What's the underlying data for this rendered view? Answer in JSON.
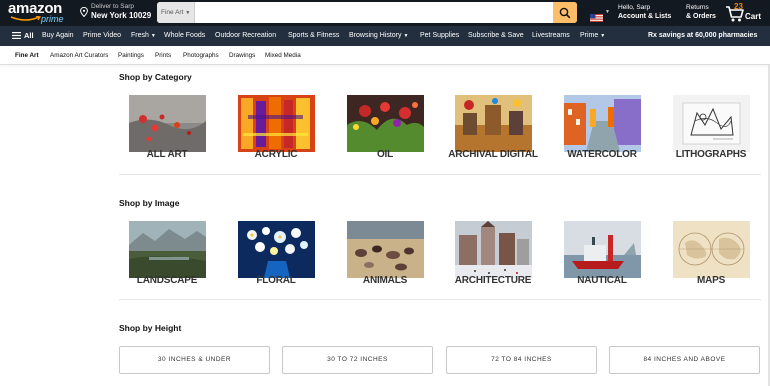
{
  "header": {
    "logo_text": "amazon",
    "logo_sub": "prime",
    "deliver_line1": "Deliver to Sarp",
    "deliver_line2": "New York 10029",
    "search_category": "Fine Art",
    "search_value": "",
    "search_placeholder": "",
    "account_line1": "Hello, Sarp",
    "account_line2": "Account & Lists",
    "orders_line1": "Returns",
    "orders_line2": "& Orders",
    "cart_count": "23",
    "cart_label": "Cart"
  },
  "nav": {
    "all": "All",
    "items": [
      "Buy Again",
      "Prime Video",
      "Fresh",
      "Whole Foods",
      "Outdoor Recreation",
      "Sports & Fitness",
      "Browsing History",
      "Pet Supplies",
      "Subscribe & Save",
      "Livestreams",
      "Prime"
    ],
    "promo": "Rx savings at 60,000 pharmacies"
  },
  "subnav": {
    "items": [
      "Fine Art",
      "Amazon Art Curators",
      "Paintings",
      "Prints",
      "Photographs",
      "Drawings",
      "Mixed Media"
    ]
  },
  "sections": {
    "category_title": "Shop by Category",
    "categories": [
      "ALL ART",
      "ACRYLIC",
      "OIL",
      "ARCHIVAL DIGITAL",
      "WATERCOLOR",
      "LITHOGRAPHS"
    ],
    "image_title": "Shop by Image",
    "images": [
      "LANDSCAPE",
      "FLORAL",
      "ANIMALS",
      "ARCHITECTURE",
      "NAUTICAL",
      "MAPS"
    ],
    "height_title": "Shop by Height",
    "heights": [
      "30 INCHES & UNDER",
      "30 TO 72 INCHES",
      "72 TO 84 INCHES",
      "84 INCHES AND ABOVE"
    ]
  },
  "colors": {
    "header_bg": "#131921",
    "nav_bg": "#232f3e",
    "search_button": "#febd69",
    "prime_blue": "#7fd4ff"
  },
  "icons": [
    "amazon-smile-icon",
    "location-pin-icon",
    "search-icon",
    "us-flag-icon",
    "cart-icon",
    "menu-icon"
  ]
}
